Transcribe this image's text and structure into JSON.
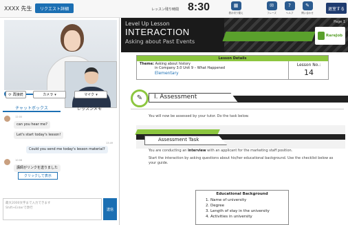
{
  "topbar": {
    "tutor_name": "XXXX 先生",
    "request_button": "リクエスト詳細",
    "remaining_label": "レッスン残り時間",
    "remaining_time": "8:30",
    "icons": [
      {
        "name": "layout-switch-icon",
        "caption": "表示切り替え"
      },
      {
        "name": "phrase-icon",
        "caption": "フレーズ"
      },
      {
        "name": "help-icon",
        "caption": "ヘルプ"
      },
      {
        "name": "contact-icon",
        "caption": "問い合わせ"
      }
    ],
    "exit_button": "退室する"
  },
  "controls": {
    "reconnect": "再接続",
    "camera": "カメラ",
    "mic": "マイク"
  },
  "chat": {
    "tabs": [
      "チャットボックス",
      "レッスンメモ"
    ],
    "messages": [
      {
        "time": "12:00",
        "text": "can you hear me?"
      },
      {
        "time": "",
        "text": "Let's start today's lesson!"
      },
      {
        "time": "13:49",
        "text": "Could you send me today's lesson material?"
      },
      {
        "time": "10:08",
        "text": "講師がリンクを送りました"
      }
    ],
    "show_button": "クリックして表示",
    "input_placeholder_1": "最大2000文字まで入力できます",
    "input_placeholder_2": "Shift+Enterで改行",
    "send_button": "送信"
  },
  "material": {
    "level_line": "Level Up Lesson",
    "title": "INTERACTION",
    "subtitle": "Asking about Past Events",
    "page": "Page 1",
    "logo_text": "RareJob",
    "lesson_details": {
      "header": "Lesson Details",
      "theme_label": "Theme:",
      "theme_value": "Asking about history",
      "company_line": "in Company 3.0 Unit 9 – What Happened",
      "level": "Elementary",
      "lesson_no_label": "Lesson No.:",
      "lesson_no": "14"
    },
    "assessment": {
      "heading": "I. Assessment",
      "text": "You will now be assessed by your tutor. Do the task below."
    },
    "task": {
      "heading": "Assessment Task",
      "p1_pre": "You are conducting an ",
      "p1_bold": "interview",
      "p1_post": " with an applicant for the marketing staff position.",
      "p2": "Start the interaction by asking questions about his/her educational background. Use the checklist below as your guide."
    },
    "education": {
      "title": "Educational Background",
      "items": [
        "1.   Name of university",
        "2.   Degree",
        "3.   Length of stay in the university",
        "4.   Activities in university"
      ]
    }
  }
}
